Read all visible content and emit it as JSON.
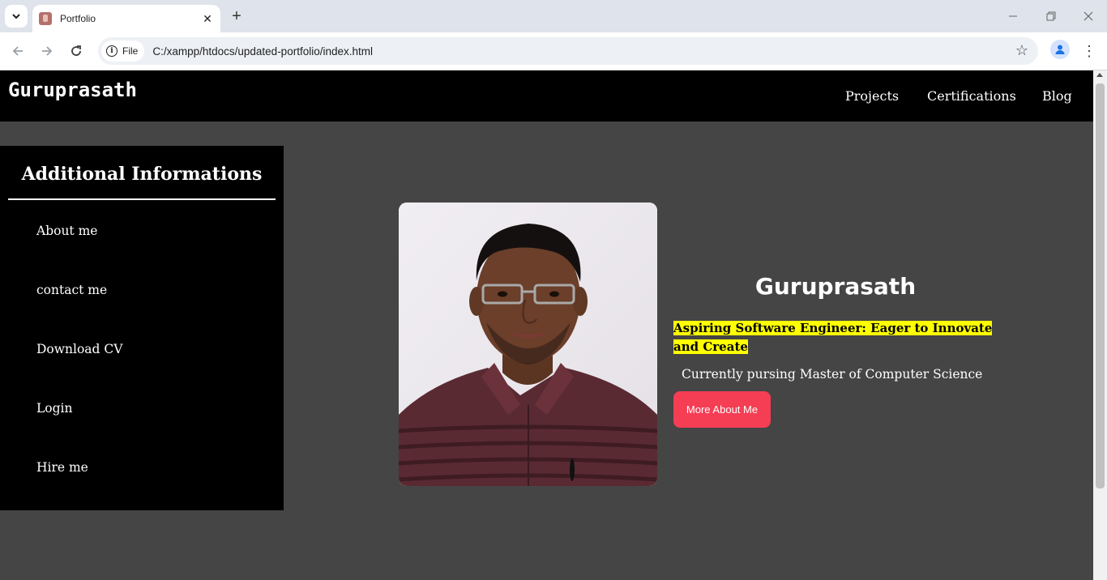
{
  "browser": {
    "tab_title": "Portfolio",
    "site_chip_label": "File",
    "url": "C:/xampp/htdocs/updated-portfolio/index.html"
  },
  "header": {
    "brand": "Guruprasath",
    "nav": [
      "Projects",
      "Certifications",
      "Blog"
    ]
  },
  "sidebar": {
    "title": "Additional Informations",
    "items": [
      "About me",
      "contact me",
      "Download CV",
      "Login",
      "Hire me"
    ]
  },
  "hero": {
    "name": "Guruprasath",
    "tagline": "Aspiring Software Engineer: Eager to Innovate and Create",
    "subtitle": "Currently pursing Master of Computer Science",
    "button_label": "More About Me"
  },
  "colors": {
    "page_background": "#454545",
    "header_background": "#000000",
    "tagline_highlight": "#ffff00",
    "button_background": "#f53d54"
  }
}
